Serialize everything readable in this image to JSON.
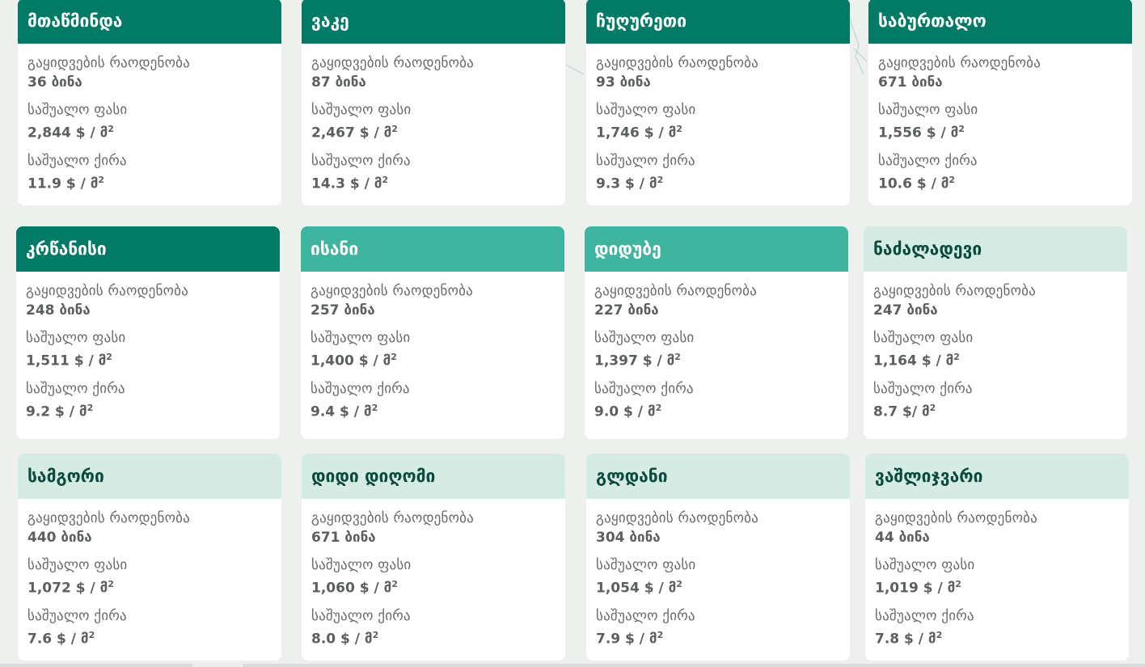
{
  "labels": {
    "sales": "გაყიდვების რაოდენობა",
    "avg_price": "საშუალო ფასი",
    "avg_rent": "საშუალო ქირა"
  },
  "cards": [
    {
      "name": "მთაწმინდა",
      "style": "dark",
      "sales": "36 ბინა",
      "price": "2,844 $ / მ",
      "rent": "11.9 $ / მ"
    },
    {
      "name": "ვაკე",
      "style": "dark",
      "sales": "87 ბინა",
      "price": "2,467 $ / მ",
      "rent": "14.3 $ / მ"
    },
    {
      "name": "ჩუღურეთი",
      "style": "dark",
      "sales": "93 ბინა",
      "price": "1,746 $ / მ",
      "rent": "9.3 $ / მ"
    },
    {
      "name": "საბურთალო",
      "style": "dark",
      "sales": "671 ბინა",
      "price": "1,556 $ / მ",
      "rent": "10.6 $ / მ"
    },
    {
      "name": "კრწანისი",
      "style": "dark",
      "sales": "248 ბინა",
      "price": "1,511 $ / მ",
      "rent": "9.2 $ / მ"
    },
    {
      "name": "ისანი",
      "style": "medium",
      "sales": "257 ბინა",
      "price": "1,400 $ / მ",
      "rent": "9.4 $ / მ"
    },
    {
      "name": "დიდუბე",
      "style": "medium",
      "sales": "227 ბინა",
      "price": "1,397 $ / მ",
      "rent": "9.0 $ / მ"
    },
    {
      "name": "ნაძალადევი",
      "style": "light",
      "sales": "247 ბინა",
      "price": "1,164 $ / მ",
      "rent": "8.7 $/ მ"
    },
    {
      "name": "სამგორი",
      "style": "light",
      "sales": "440 ბინა",
      "price": "1,072 $ / მ",
      "rent": "7.6 $ / მ"
    },
    {
      "name": "დიდი დიღომი",
      "style": "light",
      "sales": "671 ბინა",
      "price": "1,060 $ / მ",
      "rent": "8.0 $ / მ"
    },
    {
      "name": "გლდანი",
      "style": "light",
      "sales": "304 ბინა",
      "price": "1,054 $ / მ",
      "rent": "7.9 $ / მ"
    },
    {
      "name": "ვაშლიჯვარი",
      "style": "light",
      "sales": "44 ბინა",
      "price": "1,019 $ / მ",
      "rent": "7.8 $ / მ"
    }
  ],
  "unit_suffix": "2",
  "colors": {
    "dark": "#017a66",
    "medium": "#3fb59f",
    "light": "#d5ebe3",
    "background": "#eef0ee"
  }
}
